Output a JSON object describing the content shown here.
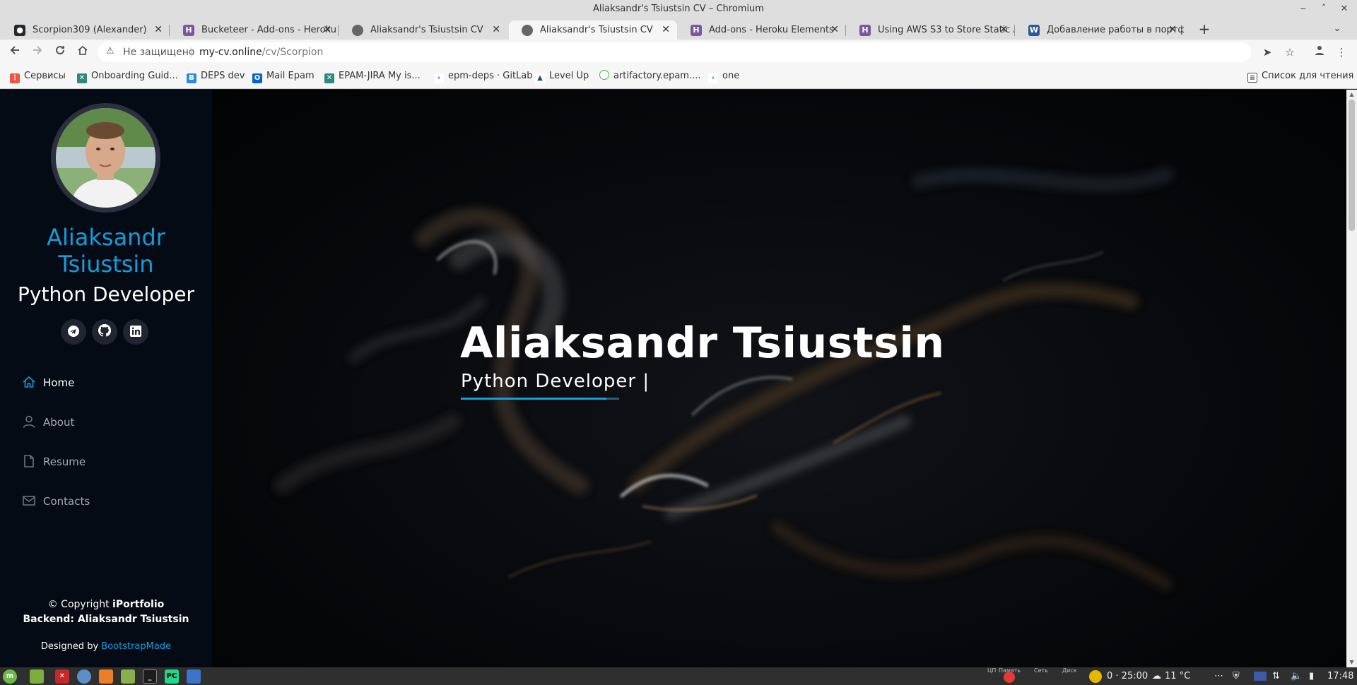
{
  "window": {
    "title": "Aliaksandr's Tsiustsin CV – Chromium",
    "minimize": "‒",
    "maximize": "˄",
    "close": "✕"
  },
  "tabs": [
    {
      "label": "Scorpion309 (Alexander)",
      "icon": "github-icon",
      "active": false
    },
    {
      "label": "Bucketeer - Add-ons - Heroku",
      "icon": "heroku-icon",
      "active": false
    },
    {
      "label": "Aliaksandr's Tsiustsin CV",
      "icon": "globe-icon",
      "active": false
    },
    {
      "label": "Aliaksandr's Tsiustsin CV",
      "icon": "globe-icon",
      "active": true
    },
    {
      "label": "Add-ons - Heroku Elements",
      "icon": "heroku-icon",
      "active": false
    },
    {
      "label": "Using AWS S3 to Store Static A",
      "icon": "heroku-icon",
      "active": false
    },
    {
      "label": "Добавление работы в портф",
      "icon": "word-icon",
      "active": false
    }
  ],
  "new_tab": "+",
  "tab_search": "⌄",
  "toolbar": {
    "insecure_label": "Не защищено",
    "url_host": "my-cv.online",
    "url_path": "/cv/Scorpion"
  },
  "bookmarks": [
    {
      "label": "Сервисы",
      "icon": "apps-icon"
    },
    {
      "label": "Onboarding Guid...",
      "icon": "epam-icon"
    },
    {
      "label": "DEPS dev",
      "icon": "deps-icon"
    },
    {
      "label": "Mail Epam",
      "icon": "outlook-icon"
    },
    {
      "label": "EPAM-JIRA My is...",
      "icon": "jira-icon"
    },
    {
      "label": "epm-deps · GitLab",
      "icon": "gitlab-icon"
    },
    {
      "label": "Level Up",
      "icon": "levelup-icon"
    },
    {
      "label": "artifactory.epam....",
      "icon": "artifactory-icon"
    },
    {
      "label": "one",
      "icon": "one-icon"
    }
  ],
  "reading_list": "Список для чтения",
  "sidebar": {
    "name_line1": "Aliaksandr",
    "name_line2": "Tsiustsin",
    "role": "Python Developer",
    "social": [
      "telegram-icon",
      "github-icon",
      "linkedin-icon"
    ],
    "menu": [
      {
        "label": "Home",
        "icon": "home-icon",
        "active": true
      },
      {
        "label": "About",
        "icon": "person-icon",
        "active": false
      },
      {
        "label": "Resume",
        "icon": "file-icon",
        "active": false
      },
      {
        "label": "Contacts",
        "icon": "envelope-icon",
        "active": false
      }
    ],
    "footer_copyright_prefix": "© Copyright ",
    "footer_brand": "iPortfolio",
    "footer_backend": "Backend: Aliaksandr Tsiustsin",
    "credits_prefix": "Designed by ",
    "credits_link": "BootstrapMade"
  },
  "hero": {
    "title": "Aliaksandr Tsiustsin",
    "subtitle": "Python Developer |"
  },
  "taskbar": {
    "tray_labels": [
      "ЦП",
      "Память",
      "Сеть",
      "Диск"
    ],
    "timer": "0 · 25:00",
    "weather": "11 °C",
    "time": "17:48"
  },
  "colors": {
    "accent": "#149ddd",
    "sidebar_bg": "#040b14",
    "social_bg": "#212431"
  }
}
